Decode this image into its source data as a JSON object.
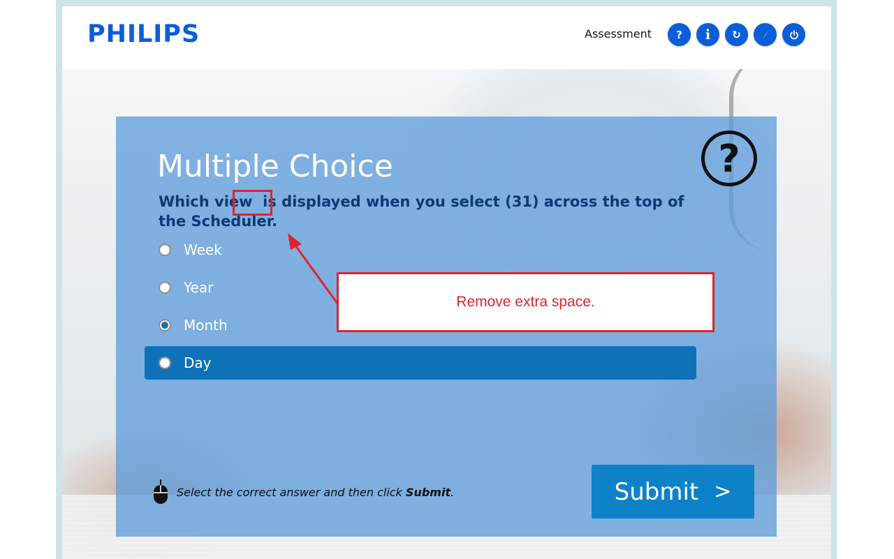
{
  "header": {
    "logo": "PHILIPS",
    "title": "Assessment",
    "buttons": [
      {
        "name": "help",
        "glyph": "?"
      },
      {
        "name": "info",
        "glyph": "i"
      },
      {
        "name": "refresh",
        "glyph": "↻"
      },
      {
        "name": "compass",
        "glyph": "⟋"
      },
      {
        "name": "power",
        "glyph": "⏻"
      }
    ]
  },
  "card": {
    "title": "Multiple Choice",
    "help_badge": "?",
    "question": "Which view  is displayed when you select (31) across the top of the Scheduler.",
    "options": [
      {
        "label": "Week",
        "checked": false
      },
      {
        "label": "Year",
        "checked": false
      },
      {
        "label": "Month",
        "checked": true
      },
      {
        "label": "Day",
        "checked": false,
        "hovered": true
      }
    ],
    "hint_prefix": "Select the correct answer and then click ",
    "hint_bold": "Submit",
    "hint_suffix": ".",
    "submit_label": "Submit",
    "submit_chevron": ">"
  },
  "annotation": {
    "callout_text": "Remove extra space.",
    "color": "#e0242b"
  },
  "colors": {
    "brand_blue": "#0b5ed7",
    "card_blue": "#609ddb",
    "option_hover": "#0f72b9",
    "submit_bg": "#0e82c8"
  }
}
